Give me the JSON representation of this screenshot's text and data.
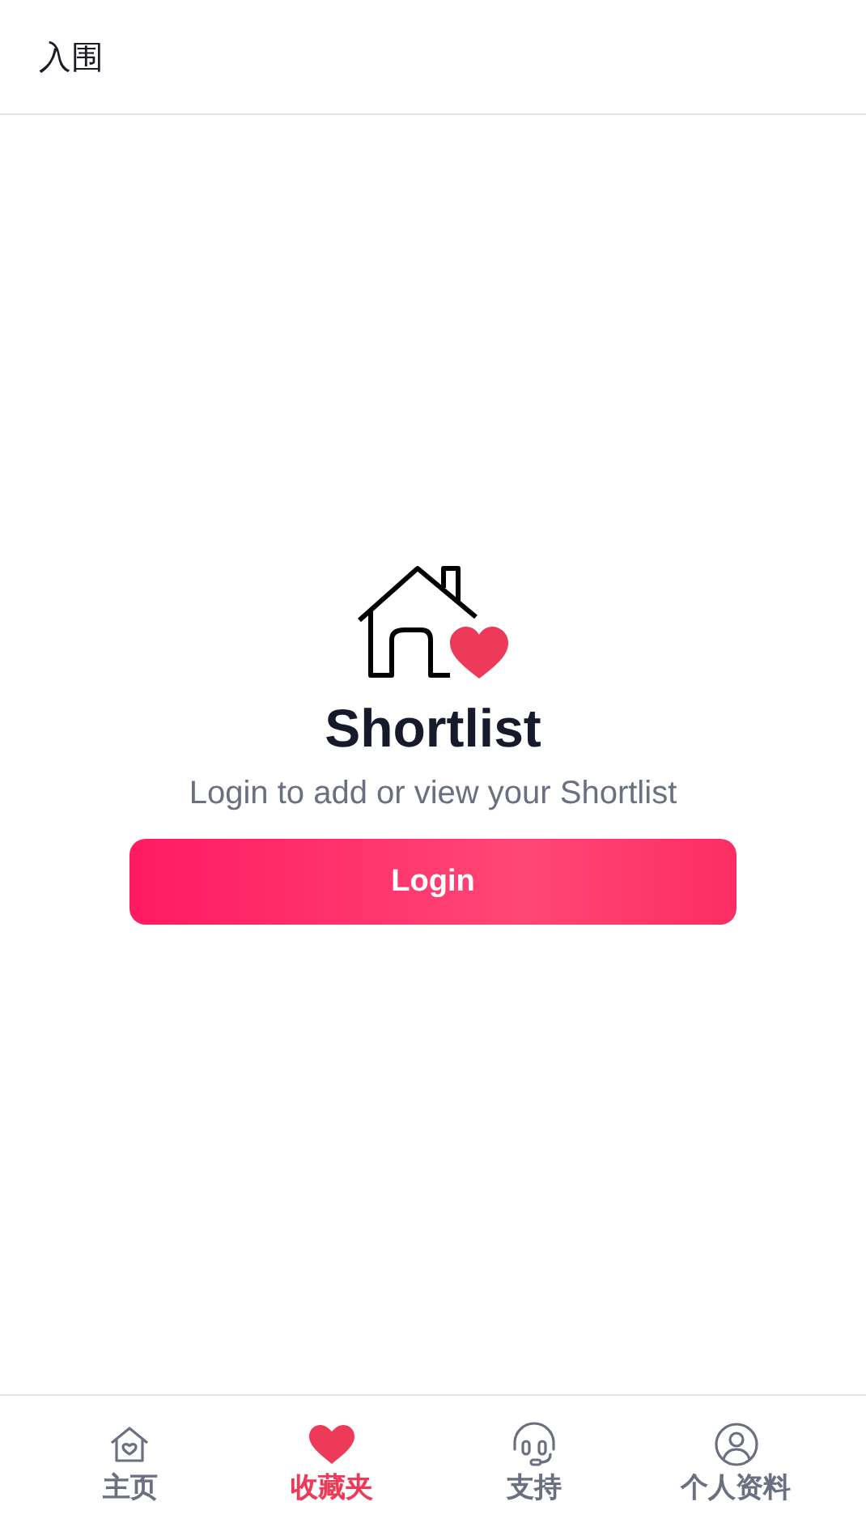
{
  "header": {
    "title": "入围"
  },
  "empty_state": {
    "title": "Shortlist",
    "message": "Login to add or view your Shortlist",
    "button": "Login"
  },
  "tab_bar": [
    {
      "kind": "home",
      "label": "主页",
      "selected": false
    },
    {
      "kind": "heart",
      "label": "收藏夹",
      "selected": true
    },
    {
      "kind": "headset",
      "label": "支持",
      "selected": false
    },
    {
      "kind": "profile",
      "label": "个人资料",
      "selected": false
    }
  ]
}
